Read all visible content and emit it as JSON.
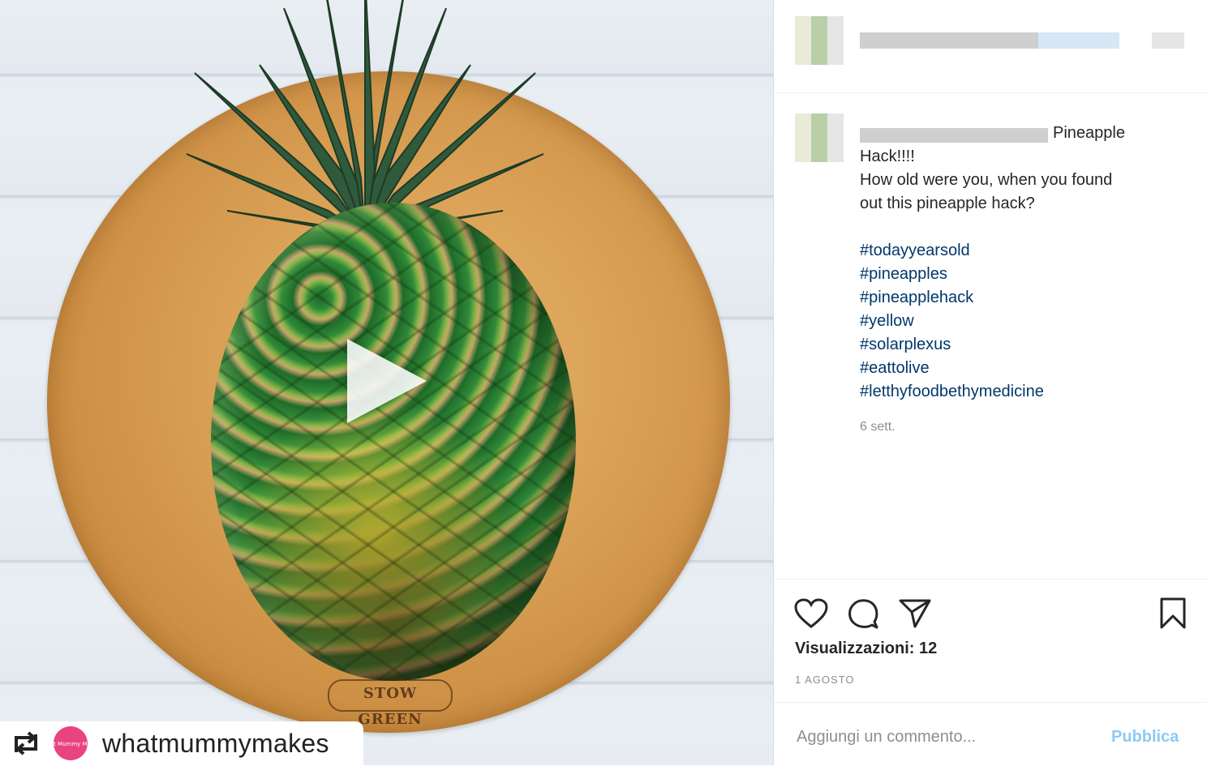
{
  "media": {
    "board_stamp": "STOW GREEN",
    "repost": {
      "username": "whatmummymakes",
      "avatar_text": "What Mummy Makes"
    }
  },
  "post": {
    "caption_title": "Pineapple",
    "caption_lines": [
      "Hack!!!!",
      "How old were you, when you found",
      "out this pineapple hack?"
    ],
    "hashtags": [
      "#todayyearsold",
      "#pineapples",
      "#pineapplehack",
      "#yellow",
      "#solarplexus",
      "#eattolive",
      "#letthyfoodbethymedicine"
    ],
    "time_ago": "6 sett.",
    "views_label": "Visualizzazioni: 12",
    "date": "1 AGOSTO"
  },
  "comment": {
    "placeholder": "Aggiungi un commento...",
    "publish_label": "Pubblica"
  },
  "icons": {
    "like": "heart-icon",
    "comment": "comment-icon",
    "share": "paper-plane-icon",
    "save": "bookmark-icon",
    "play": "play-icon",
    "repost": "repost-icon"
  },
  "colors": {
    "hashtag": "#00376b",
    "publish": "#8dc9f5",
    "muted": "#8e8e8e"
  }
}
